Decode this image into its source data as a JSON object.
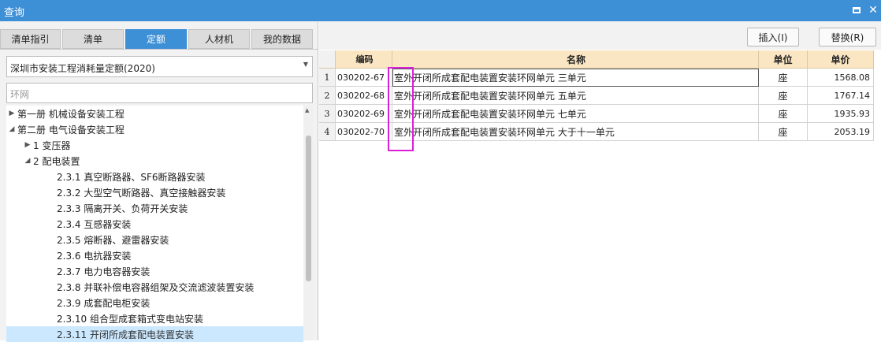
{
  "window": {
    "title": "查询"
  },
  "tabs": [
    {
      "label": "清单指引"
    },
    {
      "label": "清单"
    },
    {
      "label": "定额"
    },
    {
      "label": "人材机"
    },
    {
      "label": "我的数据"
    }
  ],
  "active_tab": "定额",
  "quota_library": {
    "selected": "深圳市安装工程消耗量定额(2020)"
  },
  "search": {
    "value": "环网"
  },
  "tree": [
    {
      "label": "第一册 机械设备安装工程",
      "expanded": false
    },
    {
      "label": "第二册 电气设备安装工程",
      "expanded": true
    },
    {
      "label": "1 变压器",
      "expanded": false
    },
    {
      "label": "2 配电装置",
      "expanded": true
    },
    {
      "label": "2.3.1 真空断路器、SF6断路器安装"
    },
    {
      "label": "2.3.2 大型空气断路器、真空接触器安装"
    },
    {
      "label": "2.3.3 隔离开关、负荷开关安装"
    },
    {
      "label": "2.3.4 互感器安装"
    },
    {
      "label": "2.3.5 熔断器、避雷器安装"
    },
    {
      "label": "2.3.6 电抗器安装"
    },
    {
      "label": "2.3.7 电力电容器安装"
    },
    {
      "label": "2.3.8 并联补偿电容器组架及交流滤波装置安装"
    },
    {
      "label": "2.3.9 成套配电柜安装"
    },
    {
      "label": "2.3.10 组合型成套箱式变电站安装"
    },
    {
      "label": "2.3.11 开闭所成套配电装置安装",
      "selected": true
    }
  ],
  "actions": {
    "insert": "插入(I)",
    "replace": "替换(R)"
  },
  "table": {
    "columns": [
      "",
      "编码",
      "名称",
      "单位",
      "单价"
    ],
    "rows": [
      {
        "no": "1",
        "code": "030202-67",
        "name": "室外开闭所成套配电装置安装环网单元 三单元",
        "unit": "座",
        "price": "1568.08"
      },
      {
        "no": "2",
        "code": "030202-68",
        "name": "室外开闭所成套配电装置安装环网单元 五单元",
        "unit": "座",
        "price": "1767.14"
      },
      {
        "no": "3",
        "code": "030202-69",
        "name": "室外开闭所成套配电装置安装环网单元 七单元",
        "unit": "座",
        "price": "1935.93"
      },
      {
        "no": "4",
        "code": "030202-70",
        "name": "室外开闭所成套配电装置安装环网单元 大于十一单元",
        "unit": "座",
        "price": "2053.19"
      }
    ]
  },
  "colors": {
    "accent": "#3d8fd6",
    "header": "#fbe6c3",
    "selection": "#cce8ff",
    "annotation": "#d820d8"
  }
}
